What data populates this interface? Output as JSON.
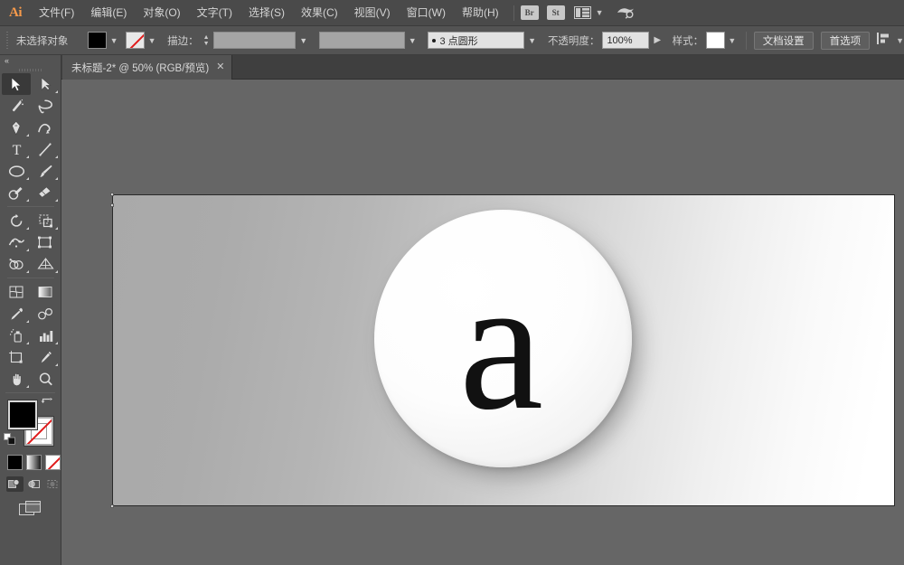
{
  "app": {
    "name": "Ai",
    "logo_label": "Ai"
  },
  "menubar": {
    "items": [
      {
        "label": "文件(F)",
        "name": "menu-file"
      },
      {
        "label": "编辑(E)",
        "name": "menu-edit"
      },
      {
        "label": "对象(O)",
        "name": "menu-object"
      },
      {
        "label": "文字(T)",
        "name": "menu-type"
      },
      {
        "label": "选择(S)",
        "name": "menu-select"
      },
      {
        "label": "效果(C)",
        "name": "menu-effect"
      },
      {
        "label": "视图(V)",
        "name": "menu-view"
      },
      {
        "label": "窗口(W)",
        "name": "menu-window"
      },
      {
        "label": "帮助(H)",
        "name": "menu-help"
      }
    ],
    "bridge_label": "Br",
    "stock_label": "St",
    "workspace_icon": "workspace-switcher-icon",
    "search_icon": "cloud-search-icon"
  },
  "options_bar": {
    "selection_status": "未选择对象",
    "fill_color": "#000000",
    "fill_swatch_name": "fill-swatch",
    "stroke_swatch_name": "stroke-swatch",
    "stroke_is_none": true,
    "stroke_label": "描边：",
    "stroke_weight_value": "",
    "brush_value": "3 点圆形",
    "opacity_label": "不透明度：",
    "opacity_value": "100%",
    "style_label": "样式：",
    "style_color": "#ffffff",
    "doc_setup_label": "文档设置",
    "preferences_label": "首选项",
    "align_icon": "align-objects-icon"
  },
  "tabbar": {
    "tab_title": "未标题-2* @ 50% (RGB/预览)",
    "close_label": "✕"
  },
  "toolbar": {
    "collapse_icon": "double-chevron-left-icon",
    "tools": [
      {
        "name": "tool-selection",
        "icon": "selection-arrow-icon",
        "active": true,
        "submenu": false
      },
      {
        "name": "tool-direct-selection",
        "icon": "direct-selection-icon",
        "active": false,
        "submenu": true
      },
      {
        "name": "tool-magic-wand",
        "icon": "magic-wand-icon",
        "active": false,
        "submenu": false
      },
      {
        "name": "tool-lasso",
        "icon": "lasso-icon",
        "active": false,
        "submenu": false
      },
      {
        "name": "tool-pen",
        "icon": "pen-icon",
        "active": false,
        "submenu": true
      },
      {
        "name": "tool-curvature",
        "icon": "curvature-icon",
        "active": false,
        "submenu": false
      },
      {
        "name": "tool-type",
        "icon": "type-icon",
        "active": false,
        "submenu": true
      },
      {
        "name": "tool-line-segment",
        "icon": "line-segment-icon",
        "active": false,
        "submenu": true
      },
      {
        "name": "tool-ellipse",
        "icon": "ellipse-icon",
        "active": false,
        "submenu": true
      },
      {
        "name": "tool-paintbrush",
        "icon": "paintbrush-icon",
        "active": false,
        "submenu": true
      },
      {
        "name": "tool-shaper",
        "icon": "shaper-pencil-icon",
        "active": false,
        "submenu": true
      },
      {
        "name": "tool-eraser",
        "icon": "eraser-icon",
        "active": false,
        "submenu": true
      },
      {
        "name": "tool-rotate",
        "icon": "rotate-icon",
        "active": false,
        "submenu": true
      },
      {
        "name": "tool-scale",
        "icon": "scale-icon",
        "active": false,
        "submenu": true
      },
      {
        "name": "tool-width",
        "icon": "width-warp-icon",
        "active": false,
        "submenu": true
      },
      {
        "name": "tool-free-transform",
        "icon": "free-transform-icon",
        "active": false,
        "submenu": false
      },
      {
        "name": "tool-shape-builder",
        "icon": "shape-builder-icon",
        "active": false,
        "submenu": true
      },
      {
        "name": "tool-perspective-grid",
        "icon": "perspective-grid-icon",
        "active": false,
        "submenu": true
      },
      {
        "name": "tool-mesh",
        "icon": "mesh-icon",
        "active": false,
        "submenu": false
      },
      {
        "name": "tool-gradient",
        "icon": "gradient-icon",
        "active": false,
        "submenu": false
      },
      {
        "name": "tool-eyedropper",
        "icon": "eyedropper-icon",
        "active": false,
        "submenu": true
      },
      {
        "name": "tool-blend",
        "icon": "blend-icon",
        "active": false,
        "submenu": false
      },
      {
        "name": "tool-symbol-sprayer",
        "icon": "symbol-sprayer-icon",
        "active": false,
        "submenu": true
      },
      {
        "name": "tool-column-graph",
        "icon": "column-graph-icon",
        "active": false,
        "submenu": true
      },
      {
        "name": "tool-artboard",
        "icon": "artboard-icon",
        "active": false,
        "submenu": false
      },
      {
        "name": "tool-slice",
        "icon": "slice-knife-icon",
        "active": false,
        "submenu": true
      },
      {
        "name": "tool-hand",
        "icon": "hand-icon",
        "active": false,
        "submenu": true
      },
      {
        "name": "tool-zoom",
        "icon": "zoom-magnifier-icon",
        "active": false,
        "submenu": false
      }
    ],
    "fill_color": "#000000",
    "stroke_color": "#ffffff",
    "stroke_is_none": true,
    "swap_icon": "swap-fill-stroke-icon",
    "default_icon": "default-fill-stroke-icon",
    "color_modes": [
      {
        "name": "color-mode-color",
        "icon": "solid-color-icon"
      },
      {
        "name": "color-mode-gradient",
        "icon": "gradient-fill-icon"
      },
      {
        "name": "color-mode-none",
        "icon": "no-fill-icon"
      }
    ],
    "draw_modes": [
      {
        "name": "draw-normal",
        "icon": "draw-normal-icon",
        "selected": true
      },
      {
        "name": "draw-behind",
        "icon": "draw-behind-icon",
        "selected": false
      },
      {
        "name": "draw-inside",
        "icon": "draw-inside-icon",
        "selected": false
      }
    ],
    "screen_mode": {
      "name": "screen-mode-button",
      "icon": "screen-mode-icon"
    }
  },
  "canvas": {
    "artboard_name": "artboard",
    "letter": "a",
    "background_gradient_from": "#a9a9a9",
    "background_gradient_to": "#ffffff",
    "disc_color": "#ffffff",
    "letter_color": "#111111",
    "watermark": ""
  }
}
